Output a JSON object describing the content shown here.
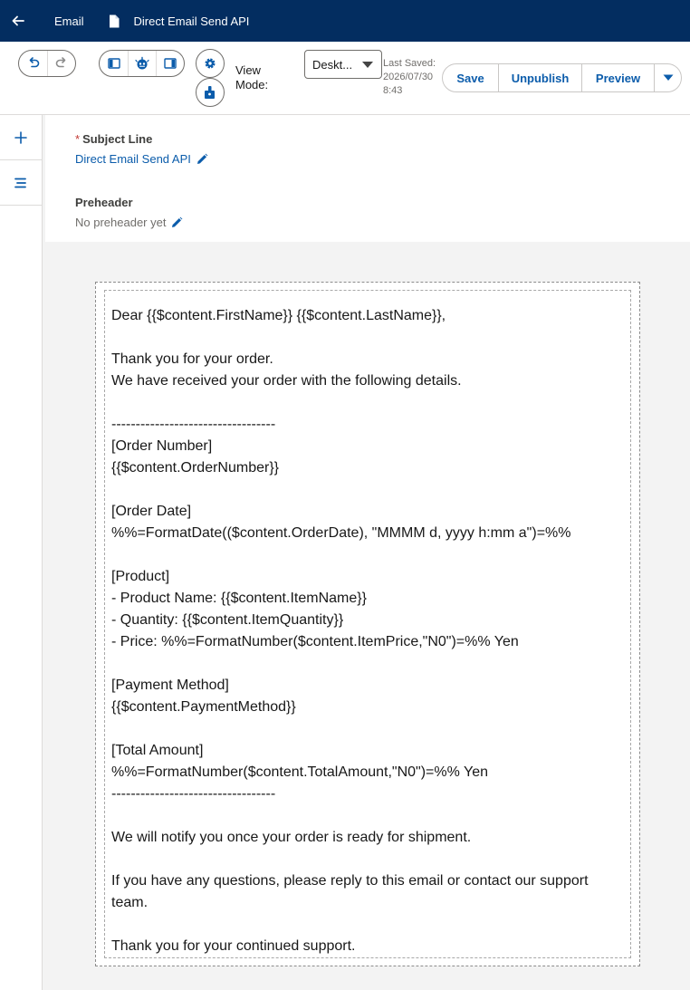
{
  "nav": {
    "tab_label": "Email",
    "doc_title": "Direct Email Send API"
  },
  "toolbar": {
    "view_mode_label": "View Mode:",
    "view_mode_value": "Deskt...",
    "last_saved_label": "Last Saved:",
    "last_saved_date": "2026/07/30",
    "last_saved_time": "8:43",
    "save_label": "Save",
    "unpublish_label": "Unpublish",
    "preview_label": "Preview"
  },
  "fields": {
    "subject_required_mark": "*",
    "subject_label": "Subject Line",
    "subject_value": "Direct Email Send API",
    "preheader_label": "Preheader",
    "preheader_value": "No preheader yet"
  },
  "email_body": {
    "lines": [
      "Dear {{$content.FirstName}} {{$content.LastName}},",
      "",
      "Thank you for your order.",
      "We have received your order with the following details.",
      "",
      "----------------------------------",
      "[Order Number]",
      "{{$content.OrderNumber}}",
      "",
      "[Order Date]",
      "%%=FormatDate(($content.OrderDate), \"MMMM d, yyyy h:mm a\")=%%",
      "",
      "[Product]",
      "- Product Name: {{$content.ItemName}}",
      "- Quantity: {{$content.ItemQuantity}}",
      "- Price: %%=FormatNumber($content.ItemPrice,\"N0\")=%% Yen",
      "",
      "[Payment Method]",
      "{{$content.PaymentMethod}}",
      "",
      "[Total Amount]",
      "%%=FormatNumber($content.TotalAmount,\"N0\")=%% Yen",
      "----------------------------------",
      "",
      "We will notify you once your order is ready for shipment.",
      "",
      "If you have any questions, please reply to this email or contact our support",
      "team.",
      "",
      "Thank you for your continued support."
    ]
  },
  "colors": {
    "nav_bg": "#032d60",
    "brand_blue": "#0b5cab",
    "required_red": "#c23934"
  },
  "icons": {
    "back": "arrow-left-icon",
    "doc": "document-icon",
    "undo": "undo-icon",
    "redo": "redo-icon",
    "left_panel": "left-panel-icon",
    "einstein": "einstein-bot-icon",
    "right_panel": "right-panel-icon",
    "settings": "gear-icon",
    "personalize": "personalize-icon",
    "dropdown": "chevron-down-icon",
    "add": "plus-icon",
    "outline": "outline-list-icon",
    "edit": "pencil-icon"
  }
}
